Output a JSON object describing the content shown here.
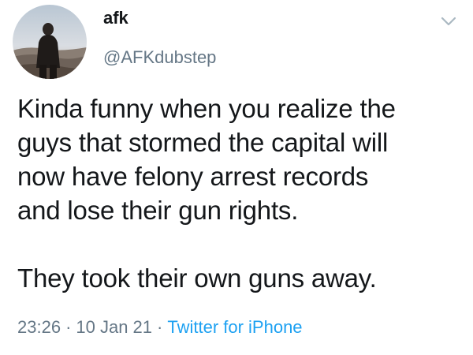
{
  "user": {
    "display_name": "afk",
    "handle": "@AFKdubstep"
  },
  "tweet": {
    "lines_p1": [
      "Kinda funny when you realize the",
      "guys that stormed the capital will",
      "now have felony arrest records",
      "and lose their gun rights."
    ],
    "lines_p2": [
      "They took their own guns away."
    ],
    "time": "23:26",
    "date": "10 Jan 21",
    "separator": "·",
    "source": "Twitter for iPhone"
  },
  "icons": {
    "menu": "chevron-down-icon",
    "avatar": "avatar-photo"
  },
  "colors": {
    "text": "#14171a",
    "secondary": "#657786",
    "link": "#1da1f2"
  }
}
